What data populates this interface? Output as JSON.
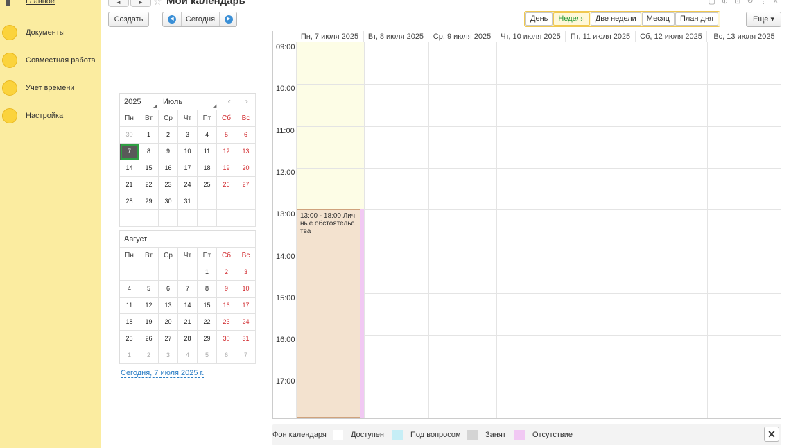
{
  "sidebar": {
    "items": [
      {
        "label": "Главное"
      },
      {
        "label": "Документы"
      },
      {
        "label": "Совместная работа"
      },
      {
        "label": "Учет времени"
      },
      {
        "label": "Настройка"
      }
    ]
  },
  "header": {
    "back": "◄",
    "forward": "►",
    "title": "Мои календарь"
  },
  "toolbar": {
    "create": "Создать",
    "today": "Сегодня",
    "more": "Еще ▾",
    "views": [
      "День",
      "Неделя",
      "Две недели",
      "Месяц",
      "План дня"
    ],
    "active_view": "Неделя"
  },
  "minical": {
    "year": "2025",
    "month": "Июль",
    "prev": "‹",
    "next": "›",
    "weekdays": [
      "Пн",
      "Вт",
      "Ср",
      "Чт",
      "Пт",
      "Сб",
      "Вс"
    ],
    "july": [
      [
        "30",
        "1",
        "2",
        "3",
        "4",
        "5",
        "6"
      ],
      [
        "7",
        "8",
        "9",
        "10",
        "11",
        "12",
        "13"
      ],
      [
        "14",
        "15",
        "16",
        "17",
        "18",
        "19",
        "20"
      ],
      [
        "21",
        "22",
        "23",
        "24",
        "25",
        "26",
        "27"
      ],
      [
        "28",
        "29",
        "30",
        "31",
        "",
        "",
        ""
      ],
      [
        "",
        "",
        "",
        "",
        "",
        "",
        ""
      ]
    ],
    "second_month": "Август",
    "august": [
      [
        "",
        "",
        "",
        "",
        "1",
        "2",
        "3"
      ],
      [
        "4",
        "5",
        "6",
        "7",
        "8",
        "9",
        "10"
      ],
      [
        "11",
        "12",
        "13",
        "14",
        "15",
        "16",
        "17"
      ],
      [
        "18",
        "19",
        "20",
        "21",
        "22",
        "23",
        "24"
      ],
      [
        "25",
        "26",
        "27",
        "28",
        "29",
        "30",
        "31"
      ],
      [
        "1",
        "2",
        "3",
        "4",
        "5",
        "6",
        "7"
      ]
    ],
    "today_link": "Сегодня, 7 июля 2025 г."
  },
  "week": {
    "days": [
      "Пн, 7 июля 2025",
      "Вт, 8 июля 2025",
      "Ср, 9 июля 2025",
      "Чт, 10 июля 2025",
      "Пт, 11 июля 2025",
      "Сб, 12 июля 2025",
      "Вс, 13 июля 2025"
    ],
    "hours": [
      "09:00",
      "10:00",
      "11:00",
      "12:00",
      "13:00",
      "14:00",
      "15:00",
      "16:00",
      "17:00"
    ],
    "event": {
      "text": "13:00 - 18:00 Личные обстоятельства"
    }
  },
  "legend": {
    "title": "Фон календаря",
    "items": [
      {
        "label": "Доступен",
        "color": "#ffffff"
      },
      {
        "label": "Под вопросом",
        "color": "#c6eef6"
      },
      {
        "label": "Занят",
        "color": "#d4d4d4"
      },
      {
        "label": "Отсутствие",
        "color": "#f1c8f3"
      }
    ],
    "close": "✕"
  }
}
